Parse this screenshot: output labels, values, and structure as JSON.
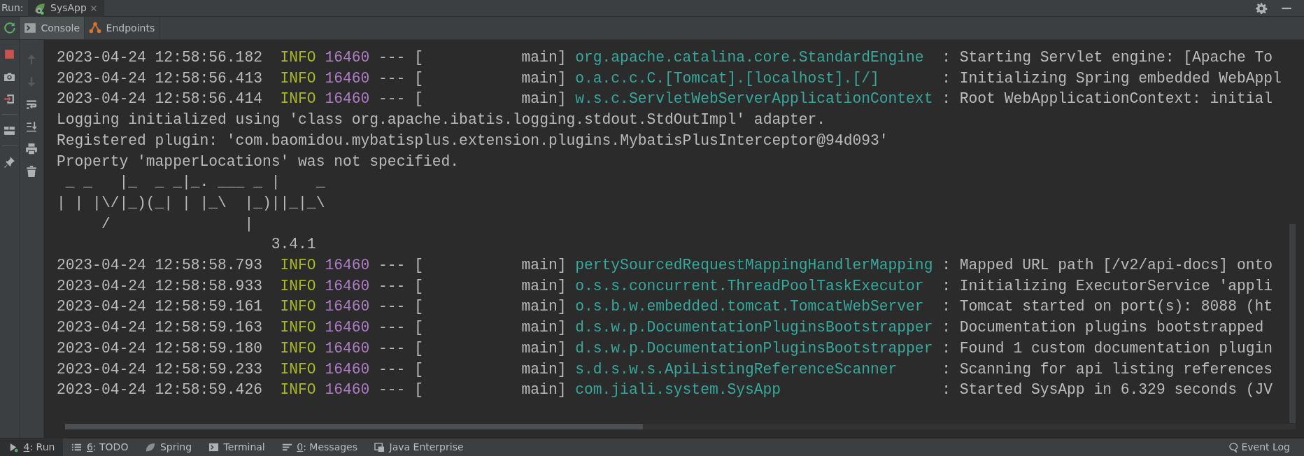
{
  "run_bar": {
    "label": "Run:",
    "tabs": [
      {
        "label": "SysApp",
        "selected": true
      }
    ]
  },
  "console_tabs": [
    {
      "label": "Console",
      "selected": true,
      "kind": "console"
    },
    {
      "label": "Endpoints",
      "selected": false,
      "kind": "endpoints"
    }
  ],
  "run_actions": [
    {
      "kind": "stop"
    },
    {
      "kind": "camera"
    },
    {
      "kind": "exit"
    },
    {
      "kind": "divider"
    },
    {
      "kind": "layout"
    },
    {
      "kind": "divider"
    },
    {
      "kind": "pin"
    }
  ],
  "console_actions": [
    {
      "kind": "up",
      "disabled": true
    },
    {
      "kind": "down",
      "disabled": true
    },
    {
      "kind": "wrap",
      "disabled": false
    },
    {
      "kind": "scroll_end",
      "disabled": false
    },
    {
      "kind": "print",
      "disabled": false
    },
    {
      "kind": "trash",
      "disabled": false
    }
  ],
  "console": {
    "lines": [
      {
        "kind": "log",
        "timestamp": "2023-04-24 12:58:56.182",
        "level": "INFO",
        "pid": "16460",
        "sep": "---",
        "thread": "[           main]",
        "logger": "org.apache.catalina.core.StandardEngine",
        "colon": ":",
        "message": "Starting Servlet engine: [Apache To"
      },
      {
        "kind": "log",
        "timestamp": "2023-04-24 12:58:56.413",
        "level": "INFO",
        "pid": "16460",
        "sep": "---",
        "thread": "[           main]",
        "logger": "o.a.c.c.C.[Tomcat].[localhost].[/]",
        "colon": ":",
        "message": "Initializing Spring embedded WebAppl"
      },
      {
        "kind": "log",
        "timestamp": "2023-04-24 12:58:56.414",
        "level": "INFO",
        "pid": "16460",
        "sep": "---",
        "thread": "[           main]",
        "logger": "w.s.c.ServletWebServerApplicationContext",
        "colon": ":",
        "message": "Root WebApplicationContext: initial"
      },
      {
        "kind": "text",
        "text": "Logging initialized using 'class org.apache.ibatis.logging.stdout.StdOutImpl' adapter."
      },
      {
        "kind": "text",
        "text": "Registered plugin: 'com.baomidou.mybatisplus.extension.plugins.MybatisPlusInterceptor@94d093'"
      },
      {
        "kind": "text",
        "text": "Property 'mapperLocations' was not specified."
      },
      {
        "kind": "text",
        "text": " _ _   |_  _ _|_. ___ _ |    _"
      },
      {
        "kind": "text",
        "text": "| | |\\/|_)(_| | |_\\  |_)||_|_\\"
      },
      {
        "kind": "text",
        "text": "     /               |"
      },
      {
        "kind": "text",
        "text": "                        3.4.1"
      },
      {
        "kind": "log",
        "timestamp": "2023-04-24 12:58:58.793",
        "level": "INFO",
        "pid": "16460",
        "sep": "---",
        "thread": "[           main]",
        "logger": "pertySourcedRequestMappingHandlerMapping",
        "colon": ":",
        "message": "Mapped URL path [/v2/api-docs] onto"
      },
      {
        "kind": "log",
        "timestamp": "2023-04-24 12:58:58.933",
        "level": "INFO",
        "pid": "16460",
        "sep": "---",
        "thread": "[           main]",
        "logger": "o.s.s.concurrent.ThreadPoolTaskExecutor",
        "colon": ":",
        "message": "Initializing ExecutorService 'appli"
      },
      {
        "kind": "log",
        "timestamp": "2023-04-24 12:58:59.161",
        "level": "INFO",
        "pid": "16460",
        "sep": "---",
        "thread": "[           main]",
        "logger": "o.s.b.w.embedded.tomcat.TomcatWebServer",
        "colon": ":",
        "message": "Tomcat started on port(s): 8088 (ht"
      },
      {
        "kind": "log",
        "timestamp": "2023-04-24 12:58:59.163",
        "level": "INFO",
        "pid": "16460",
        "sep": "---",
        "thread": "[           main]",
        "logger": "d.s.w.p.DocumentationPluginsBootstrapper",
        "colon": ":",
        "message": "Documentation plugins bootstrapped"
      },
      {
        "kind": "log",
        "timestamp": "2023-04-24 12:58:59.180",
        "level": "INFO",
        "pid": "16460",
        "sep": "---",
        "thread": "[           main]",
        "logger": "d.s.w.p.DocumentationPluginsBootstrapper",
        "colon": ":",
        "message": "Found 1 custom documentation plugin"
      },
      {
        "kind": "log",
        "timestamp": "2023-04-24 12:58:59.233",
        "level": "INFO",
        "pid": "16460",
        "sep": "---",
        "thread": "[           main]",
        "logger": "s.d.s.w.s.ApiListingReferenceScanner",
        "colon": ":",
        "message": "Scanning for api listing references"
      },
      {
        "kind": "log",
        "timestamp": "2023-04-24 12:58:59.426",
        "level": "INFO",
        "pid": "16460",
        "sep": "---",
        "thread": "[           main]",
        "logger": "com.jiali.system.SysApp",
        "colon": ":",
        "message": "Started SysApp in 6.329 seconds (JV"
      }
    ]
  },
  "tool_windows": [
    {
      "kind": "run",
      "mnemonic": "4",
      "label": ": Run",
      "selected": true
    },
    {
      "kind": "todo",
      "mnemonic": "6",
      "label": ": TODO",
      "selected": false
    },
    {
      "kind": "spring",
      "label": "Spring",
      "selected": false
    },
    {
      "kind": "terminal",
      "label": "Terminal",
      "selected": false
    },
    {
      "kind": "messages",
      "mnemonic": "0",
      "label": ": Messages",
      "selected": false
    },
    {
      "kind": "enterprise",
      "label": "Java Enterprise",
      "selected": false
    }
  ],
  "event_log": {
    "label": "Event Log"
  }
}
